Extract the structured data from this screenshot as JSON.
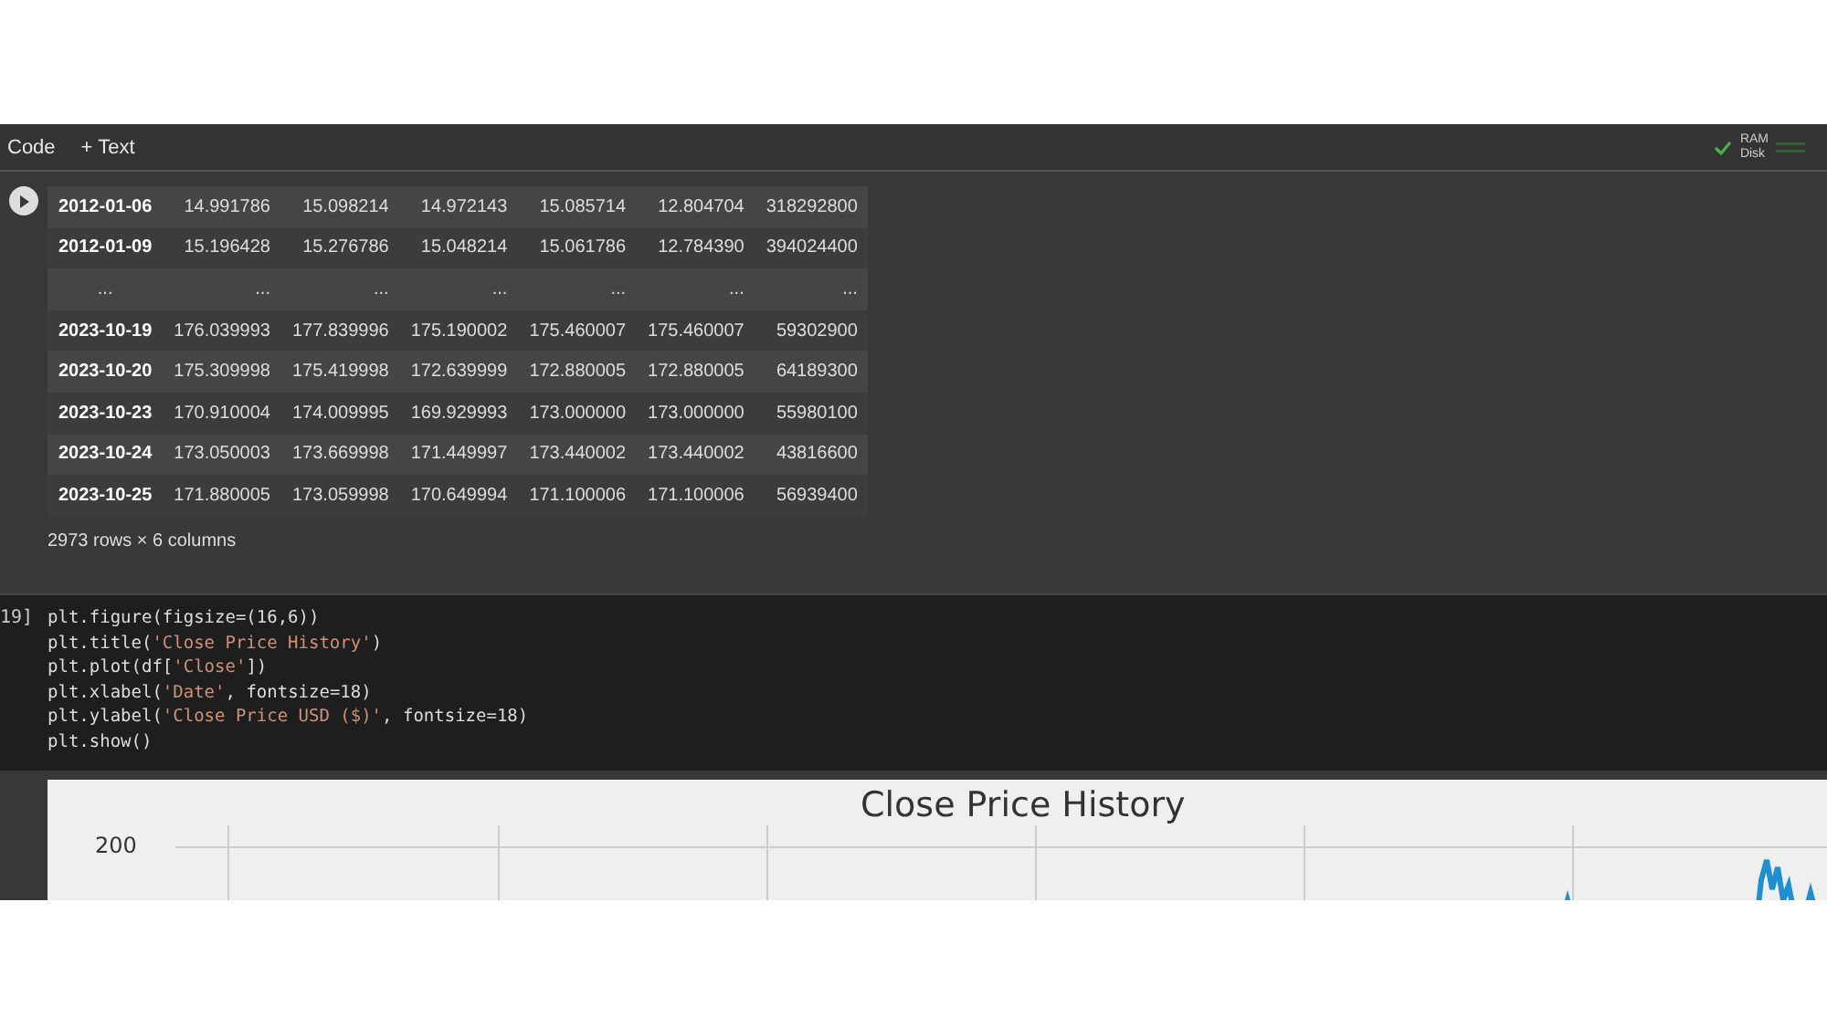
{
  "toolbar": {
    "items": [
      "Code",
      "+ Text"
    ],
    "resources": {
      "labels": [
        "RAM",
        "Disk"
      ]
    }
  },
  "output": {
    "rows": [
      {
        "kind": "data",
        "cells": [
          "2012-01-06",
          "14.991786",
          "15.098214",
          "14.972143",
          "15.085714",
          "12.804704",
          "318292800"
        ]
      },
      {
        "kind": "data",
        "cells": [
          "2012-01-09",
          "15.196428",
          "15.276786",
          "15.048214",
          "15.061786",
          "12.784390",
          "394024400"
        ]
      },
      {
        "kind": "ellipsis",
        "cells": [
          "...",
          "...",
          "...",
          "...",
          "...",
          "...",
          "..."
        ]
      },
      {
        "kind": "data",
        "cells": [
          "2023-10-19",
          "176.039993",
          "177.839996",
          "175.190002",
          "175.460007",
          "175.460007",
          "59302900"
        ]
      },
      {
        "kind": "data",
        "cells": [
          "2023-10-20",
          "175.309998",
          "175.419998",
          "172.639999",
          "172.880005",
          "172.880005",
          "64189300"
        ]
      },
      {
        "kind": "data",
        "cells": [
          "2023-10-23",
          "170.910004",
          "174.009995",
          "169.929993",
          "173.000000",
          "173.000000",
          "55980100"
        ]
      },
      {
        "kind": "data",
        "cells": [
          "2023-10-24",
          "173.050003",
          "173.669998",
          "171.449997",
          "173.440002",
          "173.440002",
          "43816600"
        ]
      },
      {
        "kind": "data",
        "cells": [
          "2023-10-25",
          "171.880005",
          "173.059998",
          "170.649994",
          "171.100006",
          "171.100006",
          "56939400"
        ]
      }
    ],
    "summary": "2973 rows × 6 columns"
  },
  "code_cell": {
    "execution_count": "19]",
    "lines": [
      "plt.figure(figsize=(16,6))",
      "plt.title('Close Price History')",
      "plt.plot(df['Close'])",
      "plt.xlabel('Date', fontsize=18)",
      "plt.ylabel('Close Price USD ($)', fontsize=18)",
      "plt.show()"
    ]
  },
  "plot": {
    "title": "Close Price History",
    "ytick": "200"
  }
}
